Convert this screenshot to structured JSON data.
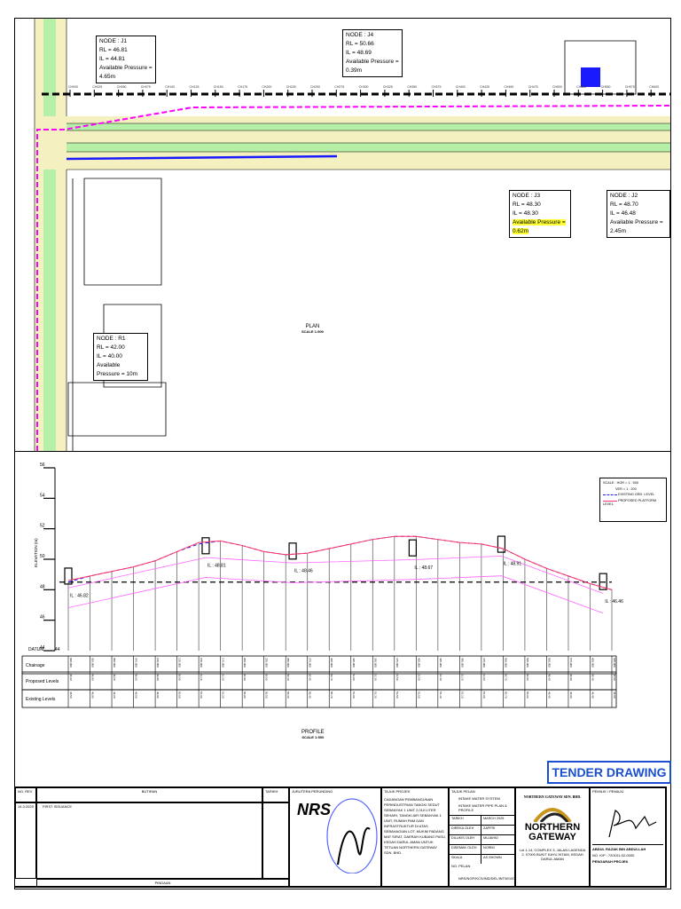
{
  "plan": {
    "title": "PLAN",
    "scale": "SCALE 1:500",
    "chainage_marks": [
      "CH000",
      "CH025",
      "CH050",
      "CH075",
      "CH100",
      "CH125",
      "CH150",
      "CH175",
      "CH200",
      "CH225",
      "CH250",
      "CH275",
      "CH300",
      "CH325",
      "CH350",
      "CH375",
      "CH400",
      "CH425",
      "CH450",
      "CH475",
      "CH500",
      "CH525",
      "CH550",
      "CH575",
      "CH600",
      "CH625"
    ],
    "nodes": [
      {
        "id": "J1",
        "node": "NODE : J1",
        "rl": "RL = 46.81",
        "il": "IL = 44.81",
        "pressure": "Available Pressure = 4.65m"
      },
      {
        "id": "J4",
        "node": "NODE : J4",
        "rl": "RL = 50.66",
        "il": "IL = 48.69",
        "pressure": "Available Pressure = 0.39m"
      },
      {
        "id": "J3",
        "node": "NODE : J3",
        "rl": "RL = 48.30",
        "il": "IL = 48.30",
        "pressure": "Available Pressure = 0.62m"
      },
      {
        "id": "J2",
        "node": "NODE : J2",
        "rl": "RL = 48.70",
        "il": "IL = 46.48",
        "pressure": "Available Pressure = 2.45m"
      },
      {
        "id": "R1",
        "node": "NODE : R1",
        "rl": "RL = 42.00",
        "il": "IL = 40.00",
        "pressure": "Available Pressure = 10m"
      }
    ],
    "colors": {
      "pipe": "#ff00ff",
      "road_green": "#b6f0a8",
      "road_yellow": "#f5f0c0",
      "blue": "#1a1aff"
    }
  },
  "chart_data": {
    "type": "line",
    "title": "PROFILE",
    "subtitle": "SCALE 1:500",
    "ylabel": "ELEVATION (m)",
    "xlabel": "Chainage",
    "ylim": [
      44,
      56
    ],
    "yticks": [
      "44",
      "46",
      "48",
      "50",
      "52",
      "54",
      "56"
    ],
    "x": [
      0,
      25,
      50,
      75,
      100,
      125,
      150,
      175,
      200,
      225,
      250,
      275,
      300,
      325,
      350,
      375,
      400,
      425,
      450,
      475,
      500,
      525,
      550,
      575,
      600,
      625
    ],
    "series": [
      {
        "name": "EXISTING GRD. LEVEL",
        "color": "#1a1aff",
        "dash": true,
        "values": [
          48.5,
          48.9,
          49.2,
          49.5,
          49.9,
          50.5,
          51.0,
          51.2,
          50.9,
          50.5,
          50.3,
          50.4,
          50.7,
          51.0,
          51.3,
          51.5,
          51.5,
          51.3,
          51.1,
          51.0,
          50.7,
          50.0,
          49.4,
          48.9,
          48.4,
          48.0
        ]
      },
      {
        "name": "PROPOSED PLATFORM LEVEL",
        "color": "#ff3366",
        "dash": false,
        "values": [
          48.6,
          48.9,
          49.2,
          49.5,
          49.9,
          50.5,
          51.1,
          51.2,
          50.9,
          50.5,
          50.3,
          50.4,
          50.7,
          51.0,
          51.3,
          51.5,
          51.5,
          51.3,
          51.1,
          51.0,
          50.7,
          50.0,
          49.4,
          48.9,
          48.4,
          48.0
        ]
      }
    ],
    "pipe_inverts": [
      {
        "ch": 0,
        "label": "IL : 46.82",
        "il": 46.82
      },
      {
        "ch": 158,
        "label": "IL : 48.81",
        "il": 48.81
      },
      {
        "ch": 258,
        "label": "IL : 48.46",
        "il": 48.46
      },
      {
        "ch": 396,
        "label": "IL : 48.67",
        "il": 48.67
      },
      {
        "ch": 498,
        "label": "IL : 48.91",
        "il": 48.91
      },
      {
        "ch": 615,
        "label": "IL : 46.46",
        "il": 46.46
      }
    ],
    "reference_level": 48.5,
    "datum": "DATUM",
    "datum_value": "44",
    "rows": [
      "Chainage",
      "Proposed Levels",
      "Existing Levels"
    ],
    "legend": {
      "placement": "top-right",
      "scale_h": "SCALE : HOR = 1 : 500",
      "scale_v": "VER = 1 : 200",
      "items": [
        "EXISTING GRD. LEVEL",
        "PROPOSED PLATFORM LEVEL"
      ]
    }
  },
  "stamp": "TENDER DRAWING",
  "title_block": {
    "rev_header": "NO. REV",
    "desc_header": "BUTIRAN",
    "date_header": "TARIKH",
    "rev_date": "14.3.2025",
    "rev_desc": "FIRST ISSUANCE",
    "footer": "PINDAAN",
    "consultant_label": "JURUTERA PERUNDING",
    "consultant_logo": "NRS",
    "project_label": "TAJUK PROJEK",
    "project_text": "CADANGAN PEMBANGUNAN PERINDUSTRIAN TANGKI SEDUT SEBANYAK 1 UNIT 2,010 LITER SEHARI, TANGKI AIR SEBANYAK 1 UNIT, RUMAH PAM DAN INFRASTRUKTUR DI ATAS SEBAHAGIAN LOT, MUKIM PADANG MAT SIRAT, DAERAH KUBANG PASU, KEDAH DARUL AMAN UNTUK TETUAN NORTHERN GATEWAY SDN. BHD.",
    "drawing_label": "TAJUK PELAN",
    "drawing_title_1": "INTAKE WATER SYSTEM",
    "drawing_title_2": "INTAKE WATER PIPE PLAN & PROFILE",
    "fields": [
      [
        "TARIKH",
        "MARCH 2025"
      ],
      [
        "DIREKA OLEH",
        "ZAFFRI"
      ],
      [
        "DILUKIS OLEH",
        "MUJAHID"
      ],
      [
        "DISEMAK OLEH",
        "NORMI"
      ],
      [
        "SKALA",
        "AS SHOWN"
      ]
    ],
    "drawing_no_label": "NO. PELAN",
    "drawing_no": "NRS/NGP/KCS/IND/DEL/INTW/100",
    "client_name": "NORTHERN GATEWAY SDN. BHD.",
    "client_logo_1": "NORTHERN",
    "client_logo_2": "GATEWAY",
    "client_address": "Lot 1-14, COMPLEX 3, JALAN LAGENDA 2, 07000 BUKIT KAYU HITAM, KEDAH DARUL AMAN",
    "owner_label": "PEMILIK / PEMAJU",
    "signatory": "ABDUL RAZAK BIN ABDULLAH",
    "signatory_ic": "NO. K/P : 720101-02-0000",
    "signatory_title": "PENGARAH PROJEK"
  }
}
